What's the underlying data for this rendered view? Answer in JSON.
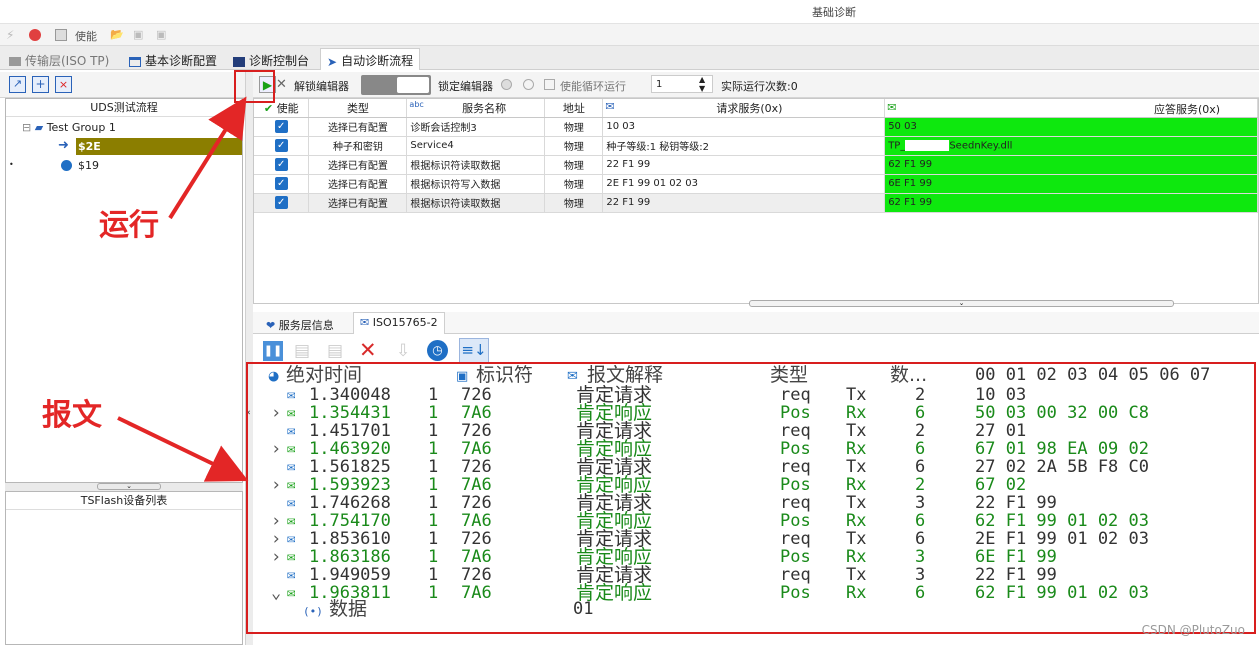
{
  "window": {
    "title": "基础诊断"
  },
  "toolbar1": {
    "enable_label": "使能"
  },
  "tabs": [
    {
      "label": "传输层(ISO TP)"
    },
    {
      "label": "基本诊断配置"
    },
    {
      "label": "诊断控制台"
    },
    {
      "label": "自动诊断流程"
    }
  ],
  "tree": {
    "header": "UDS测试流程",
    "group": "Test Group 1",
    "items": [
      {
        "label": "$2E"
      },
      {
        "label": "$19"
      }
    ]
  },
  "device_list": {
    "header": "TSFlash设备列表"
  },
  "editor_toolbar": {
    "unlock_label": "解锁编辑器",
    "lock_label": "锁定编辑器",
    "loop_label": "使能循环运行",
    "loop_count": "1",
    "run_count_label": "实际运行次数:0"
  },
  "grid": {
    "headers": [
      "使能",
      "类型",
      "abc",
      "服务名称",
      "地址",
      "请求服务(0x)",
      "应答服务(0x)"
    ],
    "rows": [
      {
        "type": "选择已有配置",
        "name": "诊断会话控制3",
        "addr": "物理",
        "request": "10 03",
        "response": "50 03"
      },
      {
        "type": "种子和密钥",
        "name": "Service4",
        "addr": "物理",
        "request": "种子等级:1 秘钥等级:2",
        "response": "TP_",
        "response_tail": "SeednKey.dll"
      },
      {
        "type": "选择已有配置",
        "name": "根据标识符读取数据",
        "addr": "物理",
        "request": "22 F1 99",
        "response": "62 F1 99"
      },
      {
        "type": "选择已有配置",
        "name": "根据标识符写入数据",
        "addr": "物理",
        "request": "2E F1 99 01 02 03",
        "response": "6E F1 99"
      },
      {
        "type": "选择已有配置",
        "name": "根据标识符读取数据",
        "addr": "物理",
        "request": "22 F1 99",
        "response": "62 F1 99"
      }
    ]
  },
  "bottom_tabs": [
    {
      "label": "服务层信息"
    },
    {
      "label": "ISO15765-2"
    }
  ],
  "trace": {
    "headers": {
      "time": "绝对时间",
      "id": "标识符",
      "decode": "报文解释",
      "type": "类型",
      "count": "数...",
      "bytes": "00 01 02 03 04 05 06 07"
    },
    "rows": [
      {
        "time": "1.340048",
        "ch": "1",
        "id": "726",
        "decode": "肯定请求",
        "type": "req",
        "dir": "Tx",
        "dlc": "2",
        "data": "10 03",
        "rx": false
      },
      {
        "time": "1.354431",
        "ch": "1",
        "id": "7A6",
        "decode": "肯定响应",
        "type": "Pos",
        "dir": "Rx",
        "dlc": "6",
        "data": "50 03 00 32 00 C8",
        "rx": true
      },
      {
        "time": "1.451701",
        "ch": "1",
        "id": "726",
        "decode": "肯定请求",
        "type": "req",
        "dir": "Tx",
        "dlc": "2",
        "data": "27 01",
        "rx": false
      },
      {
        "time": "1.463920",
        "ch": "1",
        "id": "7A6",
        "decode": "肯定响应",
        "type": "Pos",
        "dir": "Rx",
        "dlc": "6",
        "data": "67 01 98 EA 09 02",
        "rx": true
      },
      {
        "time": "1.561825",
        "ch": "1",
        "id": "726",
        "decode": "肯定请求",
        "type": "req",
        "dir": "Tx",
        "dlc": "6",
        "data": "27 02 2A 5B F8 C0",
        "rx": false
      },
      {
        "time": "1.593923",
        "ch": "1",
        "id": "7A6",
        "decode": "肯定响应",
        "type": "Pos",
        "dir": "Rx",
        "dlc": "2",
        "data": "67 02",
        "rx": true
      },
      {
        "time": "1.746268",
        "ch": "1",
        "id": "726",
        "decode": "肯定请求",
        "type": "req",
        "dir": "Tx",
        "dlc": "3",
        "data": "22 F1 99",
        "rx": false
      },
      {
        "time": "1.754170",
        "ch": "1",
        "id": "7A6",
        "decode": "肯定响应",
        "type": "Pos",
        "dir": "Rx",
        "dlc": "6",
        "data": "62 F1 99 01 02 03",
        "rx": true
      },
      {
        "time": "1.853610",
        "ch": "1",
        "id": "726",
        "decode": "肯定请求",
        "type": "req",
        "dir": "Tx",
        "dlc": "6",
        "data": "2E F1 99 01 02 03",
        "rx": false
      },
      {
        "time": "1.863186",
        "ch": "1",
        "id": "7A6",
        "decode": "肯定响应",
        "type": "Pos",
        "dir": "Rx",
        "dlc": "3",
        "data": "6E F1 99",
        "rx": true
      },
      {
        "time": "1.949059",
        "ch": "1",
        "id": "726",
        "decode": "肯定请求",
        "type": "req",
        "dir": "Tx",
        "dlc": "3",
        "data": "22 F1 99",
        "rx": false
      },
      {
        "time": "1.963811",
        "ch": "1",
        "id": "7A6",
        "decode": "肯定响应",
        "type": "Pos",
        "dir": "Rx",
        "dlc": "6",
        "data": "62 F1 99 01 02 03",
        "rx": true
      }
    ],
    "detail": {
      "label": "数据",
      "value": "01"
    }
  },
  "annotations": {
    "run": "运行",
    "message": "报文"
  },
  "watermark": "CSDN @PlutoZuo",
  "colors": {
    "response_green": "#0ee80e",
    "annotation_red": "#e32626",
    "rx_green": "#1a8a1a"
  }
}
